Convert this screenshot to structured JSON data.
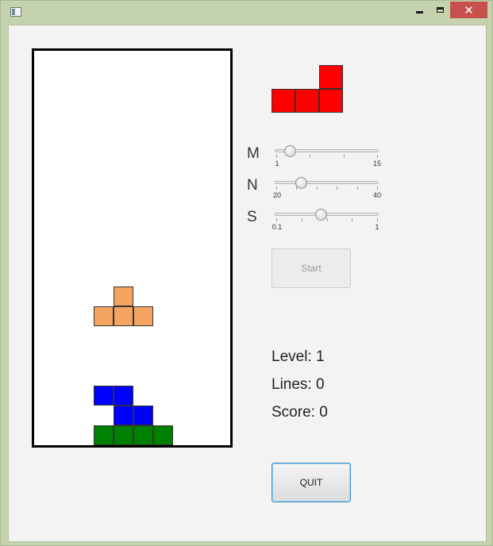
{
  "window": {
    "icon": "app-window-icon",
    "controls": {
      "minimize": "_",
      "maximize": "□",
      "close": "✕"
    }
  },
  "board": {
    "cols": 10,
    "rows": 20,
    "falling_piece": {
      "name": "T-piece",
      "color": "#f4a460",
      "cells": [
        [
          4,
          12
        ],
        [
          3,
          13
        ],
        [
          4,
          13
        ],
        [
          5,
          13
        ]
      ]
    },
    "blue_piece": {
      "name": "Z-piece",
      "color": "#0000ff",
      "cells": [
        [
          3,
          17
        ],
        [
          4,
          17
        ],
        [
          4,
          18
        ],
        [
          5,
          18
        ]
      ]
    },
    "green_piece": {
      "name": "I-piece",
      "color": "#008000",
      "cells": [
        [
          3,
          19
        ],
        [
          4,
          19
        ],
        [
          5,
          19
        ],
        [
          6,
          19
        ]
      ]
    }
  },
  "next_piece": {
    "name": "L-piece",
    "color": "#ff0000",
    "cells": [
      [
        2,
        0
      ],
      [
        0,
        1
      ],
      [
        1,
        1
      ],
      [
        2,
        1
      ]
    ]
  },
  "sliders": [
    {
      "label": "M",
      "min_label": "1",
      "max_label": "15",
      "min": 1,
      "max": 15,
      "value": 3,
      "ticks": 3
    },
    {
      "label": "N",
      "min_label": "20",
      "max_label": "40",
      "min": 20,
      "max": 40,
      "value": 25,
      "ticks": 5
    },
    {
      "label": "S",
      "min_label": "0.1",
      "max_label": "1",
      "min": 0.1,
      "max": 1,
      "value": 0.5,
      "ticks": 4
    }
  ],
  "buttons": {
    "start_label": "Start",
    "quit_label": "QUIT"
  },
  "stats": {
    "level": "Level: 1",
    "lines": "Lines: 0",
    "score": "Score: 0"
  }
}
